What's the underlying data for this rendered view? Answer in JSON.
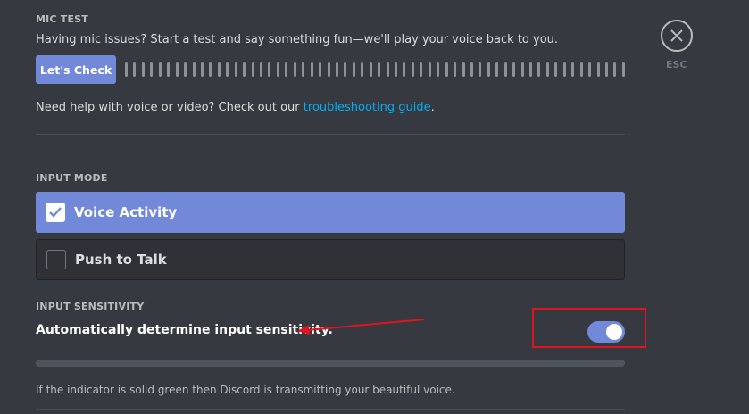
{
  "mic_test": {
    "title": "MIC TEST",
    "description": "Having mic issues? Start a test and say something fun—we'll play your voice back to you.",
    "button_label": "Let's Check",
    "help_prefix": "Need help with voice or video? Check out our ",
    "help_link": "troubleshooting guide",
    "help_suffix": "."
  },
  "input_mode": {
    "title": "INPUT MODE",
    "options": [
      {
        "label": "Voice Activity",
        "selected": true
      },
      {
        "label": "Push to Talk",
        "selected": false
      }
    ]
  },
  "input_sensitivity": {
    "title": "INPUT SENSITIVITY",
    "auto_label": "Automatically determine input sensitivity.",
    "auto_enabled": true,
    "indicator_text": "If the indicator is solid green then Discord is transmitting your beautiful voice."
  },
  "esc": {
    "label": "ESC",
    "icon": "close-icon"
  },
  "colors": {
    "accent": "#7289da",
    "background": "#36393f",
    "link": "#00b0f4",
    "annotation": "#e0141c"
  }
}
